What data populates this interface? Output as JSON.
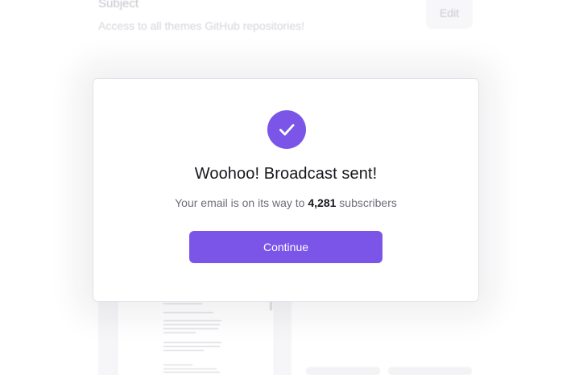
{
  "background": {
    "subject_label": "Subject",
    "subject_value": "Access to all themes GitHub repositories!",
    "edit_label": "Edit"
  },
  "modal": {
    "icon": "checkmark-icon",
    "title": "Woohoo! Broadcast sent!",
    "message_prefix": "Your email is on its way to ",
    "subscriber_count": "4,281",
    "message_suffix": " subscribers",
    "continue_label": "Continue"
  },
  "colors": {
    "accent": "#7a55e8",
    "title_text": "#16171c",
    "muted_text": "#6b6d7a"
  }
}
